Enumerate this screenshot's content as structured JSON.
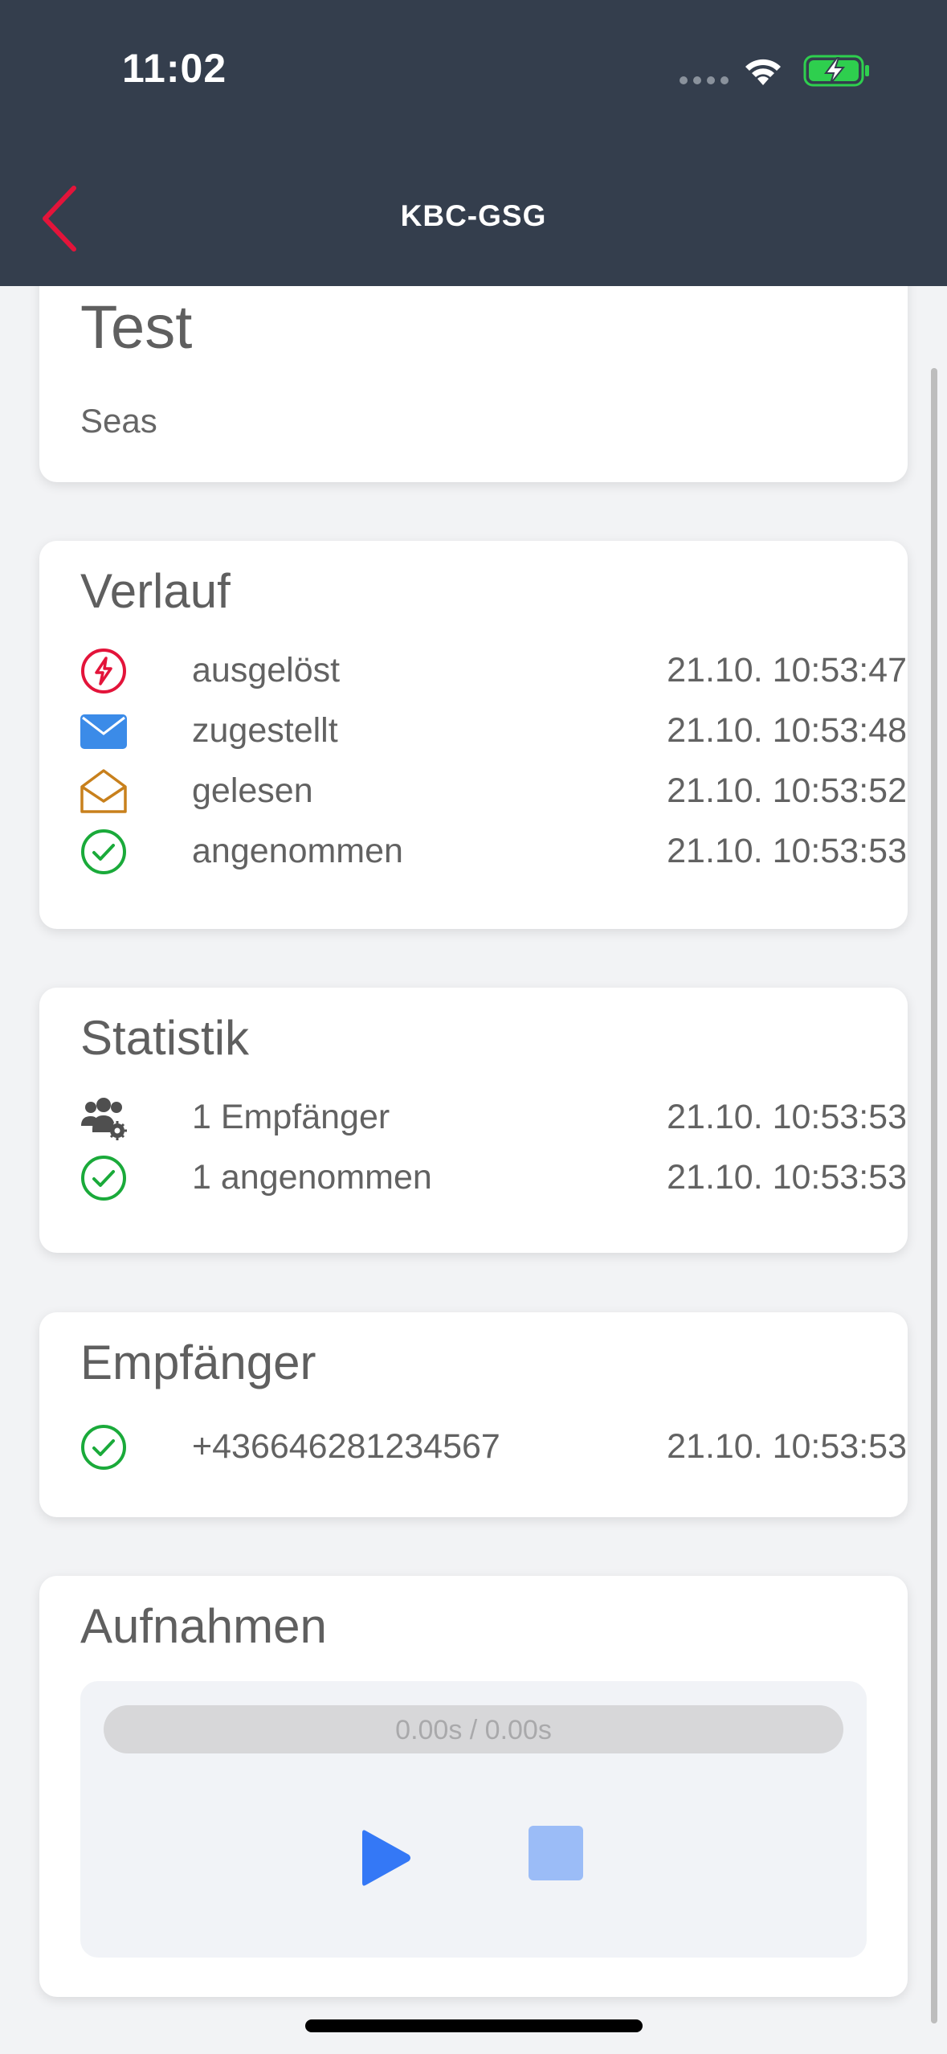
{
  "status_bar": {
    "time": "11:02"
  },
  "nav": {
    "title": "KBC-GSG",
    "accent": "#e3143a"
  },
  "message": {
    "title": "Test",
    "body": "Seas"
  },
  "history": {
    "title": "Verlauf",
    "rows": [
      {
        "icon": "lightning-circle-icon",
        "label": "ausgelöst",
        "time": "21.10. 10:53:47"
      },
      {
        "icon": "envelope-icon",
        "label": "zugestellt",
        "time": "21.10. 10:53:48"
      },
      {
        "icon": "open-envelope-icon",
        "label": "gelesen",
        "time": "21.10. 10:53:52"
      },
      {
        "icon": "check-circle-icon",
        "label": "angenommen",
        "time": "21.10. 10:53:53"
      }
    ]
  },
  "statistics": {
    "title": "Statistik",
    "rows": [
      {
        "icon": "users-gear-icon",
        "label": "1 Empfänger",
        "time": "21.10. 10:53:53"
      },
      {
        "icon": "check-circle-icon",
        "label": "1 angenommen",
        "time": "21.10. 10:53:53"
      }
    ]
  },
  "recipients": {
    "title": "Empfänger",
    "rows": [
      {
        "icon": "check-circle-icon",
        "label": "+436646281234567",
        "time": "21.10. 10:53:53"
      }
    ]
  },
  "recordings": {
    "title": "Aufnahmen",
    "progress_text": "0.00s / 0.00s",
    "progress": 0
  },
  "colors": {
    "header_bg": "#343e4d",
    "red": "#e3143a",
    "blue": "#3b8be8",
    "orange": "#c8801c",
    "green": "#1aaa3a",
    "play": "#3478f6"
  }
}
